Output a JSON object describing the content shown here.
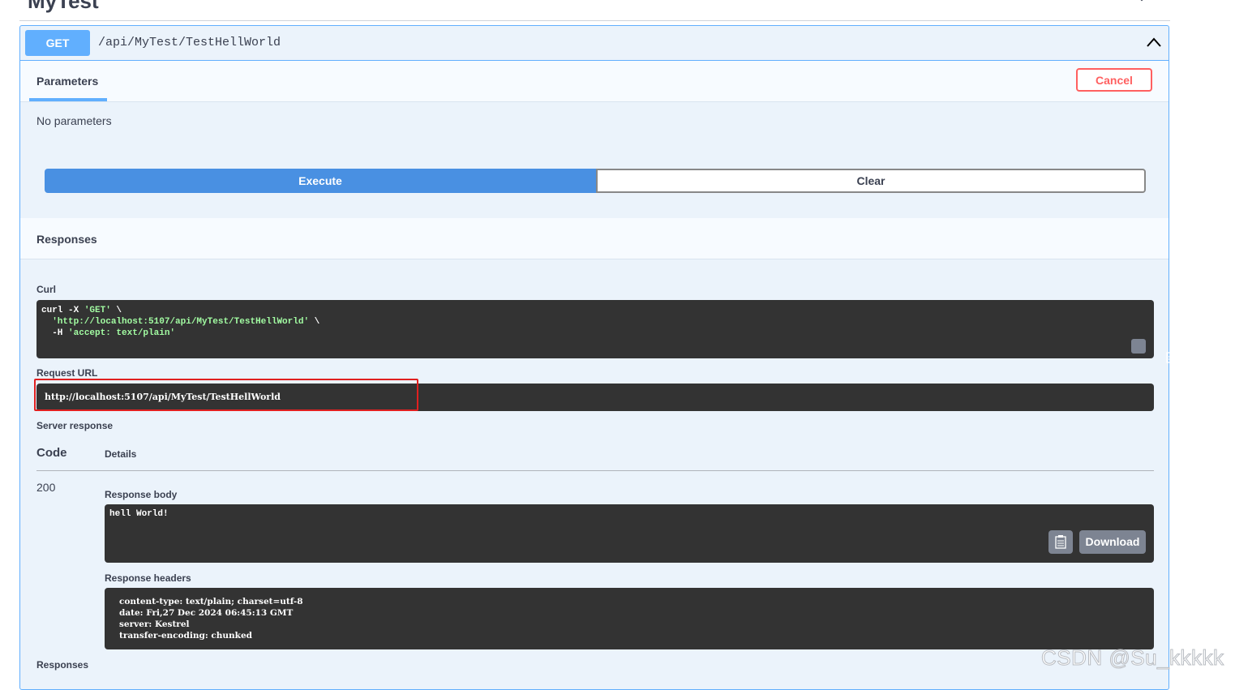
{
  "section": {
    "title": "MyTest"
  },
  "operation": {
    "method": "GET",
    "path": "/api/MyTest/TestHellWorld"
  },
  "parameters": {
    "tab_label": "Parameters",
    "cancel_label": "Cancel",
    "empty_text": "No parameters"
  },
  "actions": {
    "execute_label": "Execute",
    "clear_label": "Clear"
  },
  "responses": {
    "label": "Responses",
    "curl_label": "Curl",
    "curl_lines": {
      "l1_cmd": "curl -X ",
      "l1_str": "'GET'",
      "l1_end": " \\",
      "l2_str": "'http://localhost:5107/api/MyTest/TestHellWorld'",
      "l2_end": " \\",
      "l3_cmd": "-H ",
      "l3_str": "'accept: text/plain'"
    },
    "request_url_label": "Request URL",
    "request_url": "http://localhost:5107/api/MyTest/TestHellWorld",
    "server_response_label": "Server response",
    "code_header": "Code",
    "details_header": "Details",
    "status_code": "200",
    "body_label": "Response body",
    "body_text": "hell World!",
    "download_label": "Download",
    "headers_label": "Response headers",
    "headers_text": "content-type: text/plain; charset=utf-8\ndate: Fri,27 Dec 2024 06:45:13 GMT\nserver: Kestrel\ntransfer-encoding: chunked",
    "bottom_label": "Responses"
  },
  "watermark": "CSDN @Su_kkkkk",
  "colors": {
    "get_blue": "#61affe",
    "execute_blue": "#4990e2",
    "cancel_red": "#ff6060",
    "code_bg": "#333333",
    "highlight_red": "#e02020"
  }
}
